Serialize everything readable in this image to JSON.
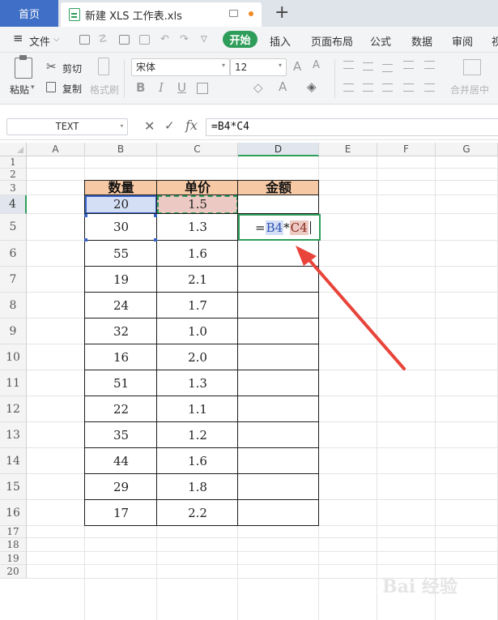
{
  "titlebar": {
    "home_tab": "首页",
    "doc_tab": "新建 XLS 工作表.xls",
    "add": "+"
  },
  "menubar": {
    "file": "文件",
    "start": "开始",
    "items": [
      "插入",
      "页面布局",
      "公式",
      "数据",
      "审阅",
      "视"
    ]
  },
  "ribbon": {
    "paste": "粘贴",
    "cut": "剪切",
    "copy": "复制",
    "format_painter": "格式刷",
    "font_name": "宋体",
    "font_size": "12",
    "merge_center": "合并居中"
  },
  "formula_bar": {
    "name_box": "TEXT",
    "formula": "=B4*C4"
  },
  "sheet": {
    "columns": [
      "A",
      "B",
      "C",
      "D",
      "E",
      "F",
      "G"
    ],
    "rows": [
      "1",
      "2",
      "3",
      "4",
      "5",
      "6",
      "7",
      "8",
      "9",
      "10",
      "11",
      "12",
      "13",
      "14",
      "15",
      "16",
      "17",
      "18",
      "19",
      "20"
    ],
    "selected_row": "4",
    "selected_column": "D",
    "table": {
      "headers": [
        "数量",
        "单价",
        "金额"
      ],
      "quantity": [
        "20",
        "30",
        "55",
        "19",
        "24",
        "32",
        "16",
        "51",
        "22",
        "35",
        "44",
        "29",
        "17"
      ],
      "price": [
        "1.5",
        "1.3",
        "1.6",
        "2.1",
        "1.7",
        "1.0",
        "2.0",
        "1.3",
        "1.1",
        "1.2",
        "1.6",
        "1.8",
        "2.2"
      ],
      "editing_cell": {
        "eq": "=",
        "ref1": "B4",
        "op": "*",
        "ref2": "C4"
      }
    }
  },
  "colors": {
    "accent_green": "#2e9d5a",
    "ref1_highlight": "#d4def4",
    "ref2_highlight": "#ecc9c3",
    "header_fill": "#f7c8a4",
    "arrow": "#e8443a"
  }
}
